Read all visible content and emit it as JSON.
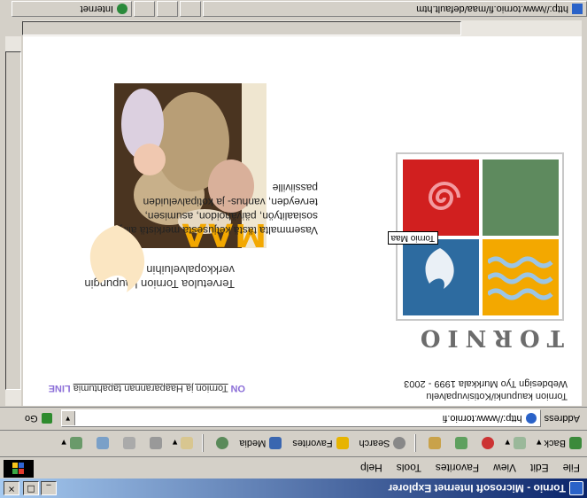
{
  "window": {
    "title": "Tornio - Microsoft Internet Explorer",
    "btn_min": "_",
    "btn_max": "□",
    "btn_close": "×"
  },
  "menu": [
    "File",
    "Edit",
    "View",
    "Favorites",
    "Tools",
    "Help"
  ],
  "toolbar": {
    "back": "Back",
    "search": "Search",
    "favorites": "Favorites",
    "media": "Media"
  },
  "address": {
    "label": "Address",
    "url": "http://www.tornio.fi",
    "go": "Go"
  },
  "page": {
    "brand": "TORNIO",
    "credit_line1": "Tornion kaupunki/Kotisivupalvelu",
    "credit_line2": "Webdesign Tyo Murkkala 1999 - 2003",
    "tooltip": "Tornio Maa",
    "welcome_line1": "Tervetuloa Tornion kaupungin",
    "welcome_line2": "verkkopalveluihin",
    "para": "Vasemmalta tästä ketjusesta merkistä aliryi sosiaalityön, päivähoidon, asumisen, terveyden, vanhus- ja kotipalveluiden passiiville",
    "maa": "MAA",
    "online_on": "ON",
    "online_mid": "Tornion ja Haaparannan tapahtumia",
    "online_line": "LINE"
  },
  "status": {
    "url": "http://www.tornio.fi/maa/default.htm",
    "zone": "Internet"
  },
  "colors": {
    "logo_yellow": "#f3a800",
    "logo_blue": "#2d6ba0",
    "logo_green": "#5e8a5e",
    "logo_red": "#d11f1f"
  }
}
